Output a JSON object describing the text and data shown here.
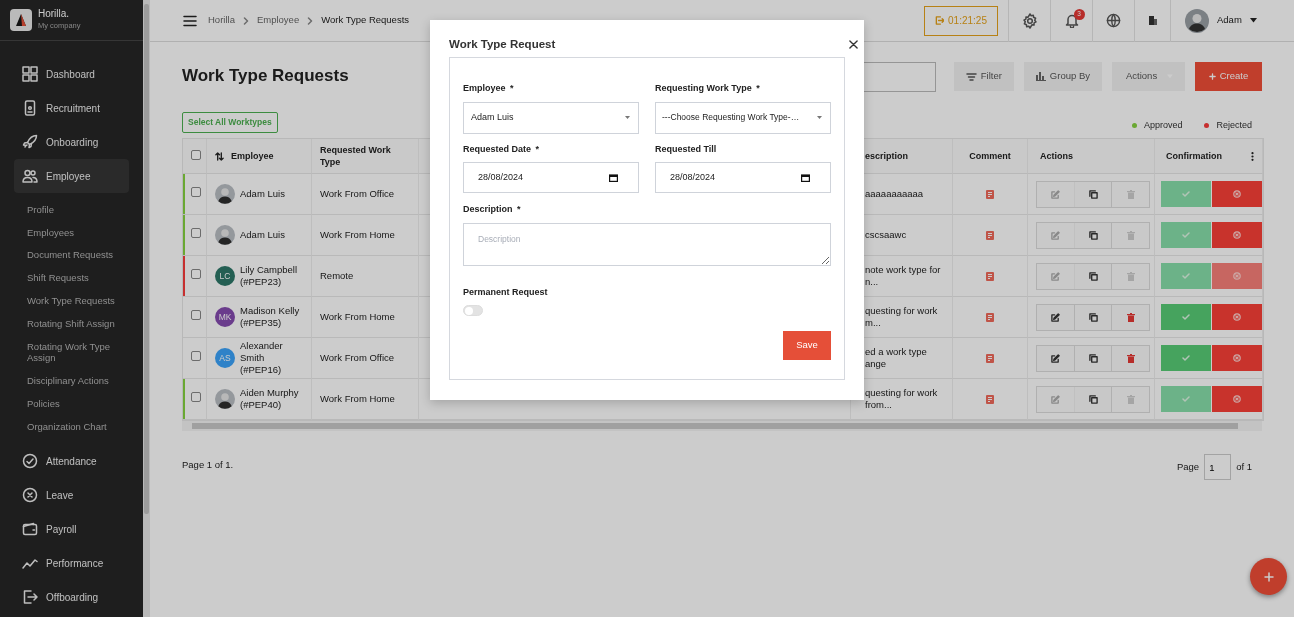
{
  "sidebar": {
    "brand": "Horilla.",
    "company": "My company",
    "items": [
      {
        "label": "Dashboard",
        "selected": false
      },
      {
        "label": "Recruitment",
        "selected": false
      },
      {
        "label": "Onboarding",
        "selected": false
      },
      {
        "label": "Employee",
        "selected": true,
        "children": [
          {
            "label": "Profile",
            "selected": false
          },
          {
            "label": "Employees",
            "selected": false
          },
          {
            "label": "Document Requests",
            "selected": false
          },
          {
            "label": "Shift Requests",
            "selected": false
          },
          {
            "label": "Work Type Requests",
            "selected": false
          },
          {
            "label": "Rotating Shift Assign",
            "selected": false
          },
          {
            "label": "Rotating Work Type Assign",
            "selected": false
          },
          {
            "label": "Disciplinary Actions",
            "selected": false
          },
          {
            "label": "Policies",
            "selected": false
          },
          {
            "label": "Organization Chart",
            "selected": false
          }
        ]
      },
      {
        "label": "Attendance",
        "selected": false
      },
      {
        "label": "Leave",
        "selected": false
      },
      {
        "label": "Payroll",
        "selected": false
      },
      {
        "label": "Performance",
        "selected": false
      },
      {
        "label": "Offboarding",
        "selected": false
      }
    ]
  },
  "topbar": {
    "breadcrumb": [
      "Horilla",
      "Employee",
      "Work Type Requests"
    ],
    "timer": "01:21:25",
    "notification_count": "3",
    "user": "Adam"
  },
  "page": {
    "title": "Work Type Requests",
    "toolbar": [
      {
        "label": "Filter",
        "kind": "filter"
      },
      {
        "label": "Group By",
        "kind": "group"
      },
      {
        "label": "Actions",
        "kind": "dropdown"
      },
      {
        "label": "Create",
        "kind": "create"
      }
    ],
    "select_all": "Select All Worktypes",
    "legend": [
      {
        "label": "Approved",
        "color": "#6aa832"
      },
      {
        "label": "Rejected",
        "color": "#c62f2f"
      }
    ]
  },
  "table": {
    "header_checked": false,
    "columns": [
      "Employee",
      "Requested Work Type",
      "escription",
      "Comment",
      "Actions",
      "Confirmation"
    ],
    "rows": [
      {
        "color": "#6aa832",
        "avatar": {
          "kind": "photo"
        },
        "name": "Adam Luis",
        "work_type": "Work From Office",
        "description": "aaaaaaaaaaa",
        "editable": false,
        "approve_enabled": false,
        "reject_enabled": true,
        "checked": false
      },
      {
        "color": "#6aa832",
        "avatar": {
          "kind": "photo"
        },
        "name": "Adam Luis",
        "work_type": "Work From Home",
        "description": "cscsaawc",
        "editable": false,
        "approve_enabled": false,
        "reject_enabled": true,
        "checked": false
      },
      {
        "color": "#c62f2f",
        "avatar": {
          "kind": "initials",
          "initials": "LC",
          "color": "#245f53"
        },
        "name": "Lily Campbell",
        "badge": "(#PEP23)",
        "work_type": "Remote",
        "description": "note work type for\nn...",
        "editable": false,
        "approve_enabled": false,
        "reject_enabled": false,
        "checked": false
      },
      {
        "avatar": {
          "kind": "initials",
          "initials": "MK",
          "color": "#6a3c8c"
        },
        "name": "Madison Kelly",
        "badge": "(#PEP35)",
        "work_type": "Work From Home",
        "description": "questing for work\nm...",
        "editable": true,
        "approve_enabled": true,
        "reject_enabled": true,
        "checked": false
      },
      {
        "avatar": {
          "kind": "initials",
          "initials": "AS",
          "color": "#2f82c8"
        },
        "name": "Alexander Smith",
        "badge": "(#PEP16)",
        "work_type": "Work From Office",
        "description": "ed a work type\nange",
        "editable": true,
        "approve_enabled": true,
        "reject_enabled": true,
        "checked": false
      },
      {
        "color": "#6aa832",
        "avatar": {
          "kind": "photo"
        },
        "name": "Aiden Murphy",
        "badge": "(#PEP40)",
        "work_type": "Work From Home",
        "description": "questing for work\nfrom...",
        "editable": false,
        "approve_enabled": false,
        "reject_enabled": true,
        "checked": false
      }
    ]
  },
  "pagination": {
    "summary": "Page 1 of 1.",
    "label": "Page",
    "value": "1",
    "total": "of 1"
  },
  "modal": {
    "title": "Work Type Request",
    "fields": [
      {
        "kind": "select",
        "label": "Employee",
        "mark": "*",
        "value": "Adam Luis"
      },
      {
        "kind": "select",
        "label": "Requesting Work Type",
        "mark": "*",
        "value": "---Choose Requesting Work Type-…"
      },
      {
        "kind": "date",
        "label": "Requested Date",
        "mark": "*",
        "value": "28/08/2024"
      },
      {
        "kind": "date",
        "label": "Requested Till",
        "value": "28/08/2024"
      },
      {
        "kind": "textarea",
        "label": "Description",
        "mark": "*",
        "placeholder": "Description"
      },
      {
        "kind": "toggle",
        "label": "Permanent Request",
        "on": false
      }
    ],
    "save": "Save"
  }
}
